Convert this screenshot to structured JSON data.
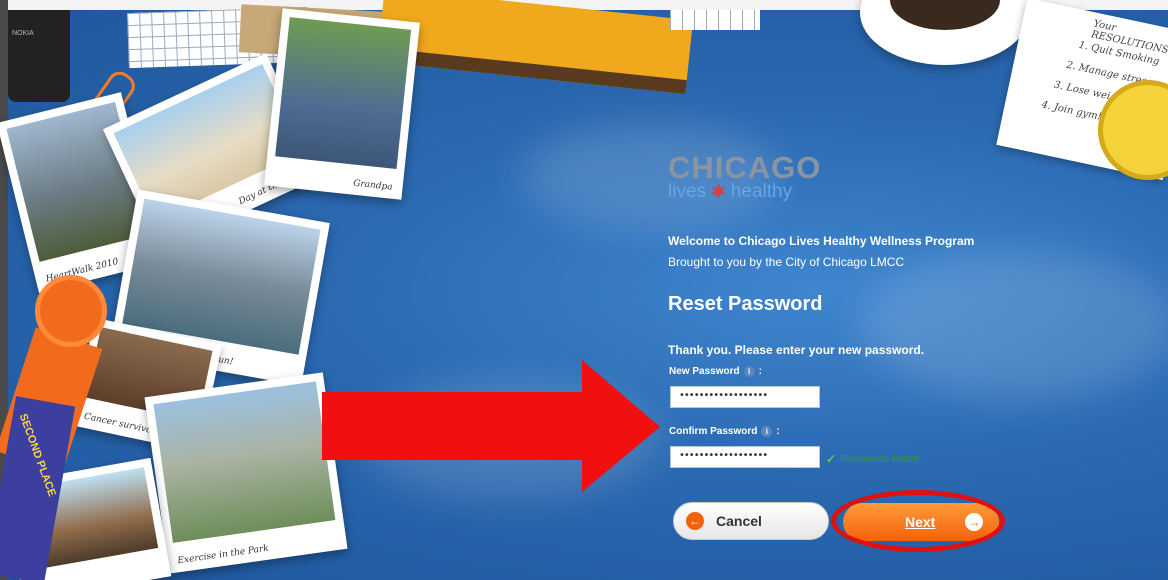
{
  "scene": {
    "phone_brand": "NOKIA",
    "note_lines": [
      "Your RESOLUTIONS",
      "1. Quit Smoking",
      "2. Manage stress",
      "3. Lose weight",
      "4. Join gym!"
    ],
    "ribbon_text": "SECOND PLACE",
    "photos": [
      {
        "caption": "HeartWalk 2010"
      },
      {
        "caption": "Day at the beach"
      },
      {
        "caption": "Grandpa"
      },
      {
        "caption": "My favorite place to run!"
      },
      {
        "caption": "Cancer survivor"
      },
      {
        "caption": "Exercise in the Park"
      }
    ]
  },
  "logo": {
    "word": "CHICAGO",
    "tagline_left": "lives",
    "tagline_star": "✱",
    "tagline_right": "healthy"
  },
  "welcome": "Welcome to Chicago Lives Healthy Wellness Program",
  "byline": "Brought to you by the City of Chicago LMCC",
  "heading": "Reset Password",
  "instructions": "Thank you. Please enter your new password.",
  "form": {
    "new_password_label": "New Password",
    "new_password_value": "••••••••••••••••••",
    "confirm_password_label": "Confirm Password",
    "confirm_password_value": "••••••••••••••••••",
    "match_text": "Passwords Match",
    "info_glyph": "i",
    "colon": ":"
  },
  "buttons": {
    "cancel_label": "Cancel",
    "next_label": "Next",
    "cancel_glyph": "←",
    "next_glyph": "→"
  },
  "colors": {
    "background": "#2f6db3",
    "accent_orange": "#f2620b",
    "annotation_red": "#e01010",
    "match_green": "#3a9a2f"
  },
  "annotations": {
    "arrow_color": "#f20f0f",
    "ring_color": "#e01010"
  }
}
